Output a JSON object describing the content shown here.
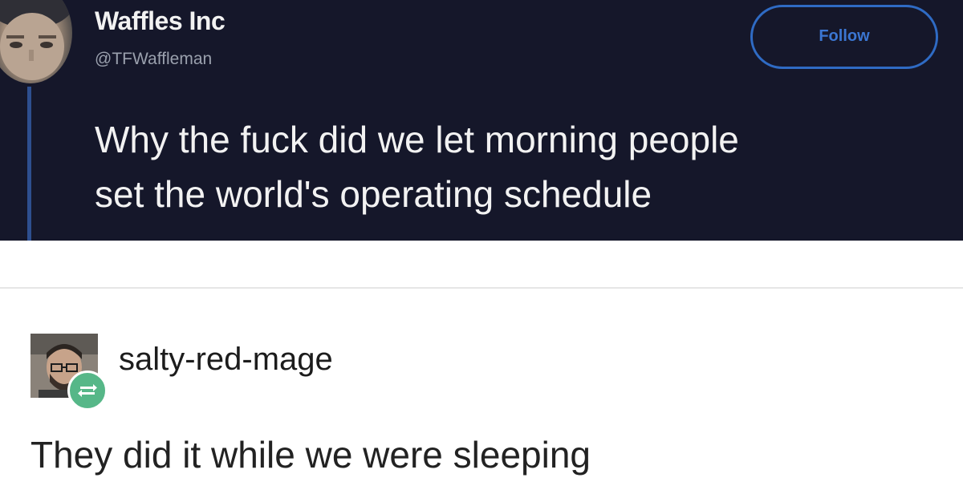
{
  "tweet": {
    "display_name": "Waffles Inc",
    "handle": "@TFWaffleman",
    "follow_label": "Follow",
    "text_lines": [
      "Why the fuck did we let morning people",
      "set the world's operating schedule"
    ],
    "background_color": "#15172a",
    "accent_color": "#2f6bc4"
  },
  "reblog": {
    "username": "salty-red-mage",
    "text": "They did it while we were sleeping",
    "reblog_icon": "reblog-arrows-icon",
    "reblog_icon_color": "#56b788"
  }
}
